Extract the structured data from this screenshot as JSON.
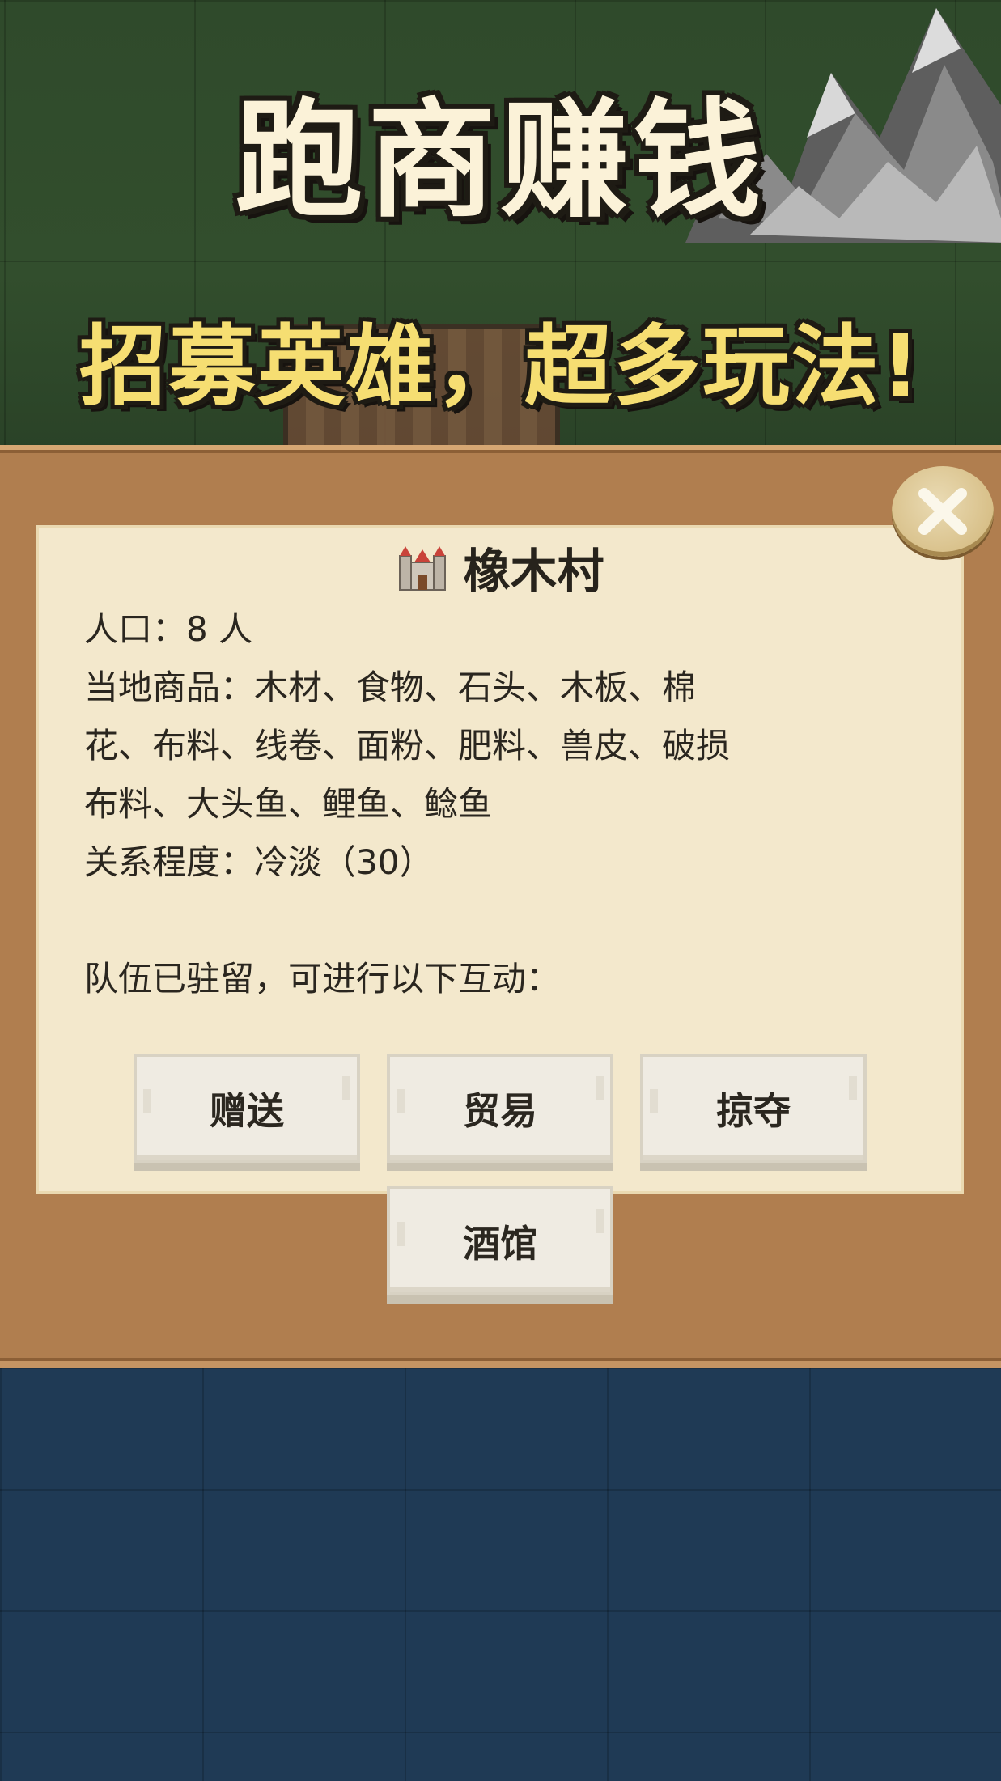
{
  "banner": {
    "title": "跑商赚钱",
    "subtitle": "招募英雄，超多玩法!"
  },
  "dialog": {
    "village_icon": "castle-icon",
    "village_name": "橡木村",
    "population": "人口：8 人",
    "goods_line1": "当地商品：木材、食物、石头、木板、棉",
    "goods_line2": "花、布料、线卷、面粉、肥料、兽皮、破损",
    "goods_line3": "布料、大头鱼、鲤鱼、鲶鱼",
    "relationship": "关系程度：冷淡（30）",
    "prompt": "队伍已驻留，可进行以下互动：",
    "buttons": {
      "gift": "赠送",
      "trade": "贸易",
      "plunder": "掠夺",
      "tavern": "酒馆"
    },
    "close_icon": "close-icon"
  },
  "colors": {
    "title_text": "#fbf2d8",
    "subtitle_text": "#f6de72",
    "frame": "#b07e4f",
    "parchment": "#f3e8cc",
    "sea": "#1f3a55"
  }
}
